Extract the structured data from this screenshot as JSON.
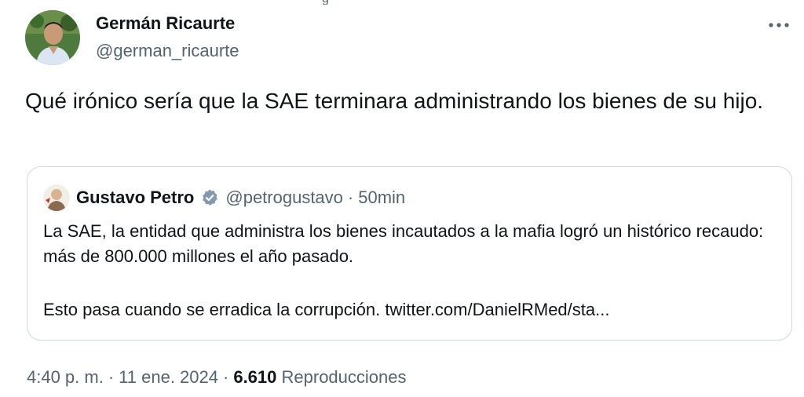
{
  "top_partial": "g",
  "tweet": {
    "author": {
      "name": "Germán Ricaurte",
      "handle": "@german_ricaurte",
      "avatar_icon": "user-avatar-photo"
    },
    "more_icon": "more-horizontal-icon",
    "text": "Qué irónico sería que la SAE terminara administrando los bienes de su hijo."
  },
  "quoted_tweet": {
    "author": {
      "name": "Gustavo Petro",
      "handle": "@petrogustavo",
      "separator": "·",
      "time": "50min",
      "verified_icon": "verified-badge-icon",
      "verified_color": "#829aab"
    },
    "text_line1": "La SAE, la entidad que administra los bienes incautados a la mafia logró un histórico recaudo: más de 800.000 millones el año pasado.",
    "text_line2": "Esto pasa cuando se erradica la corrupción. twitter.com/DanielRMed/sta..."
  },
  "meta": {
    "time": "4:40 p. m.",
    "separator": "·",
    "date": "11 ene. 2024",
    "views_count": "6.610",
    "views_label": "Reproducciones"
  },
  "colors": {
    "text_primary": "#0f1419",
    "text_secondary": "#536471",
    "border": "#cfd9de"
  }
}
